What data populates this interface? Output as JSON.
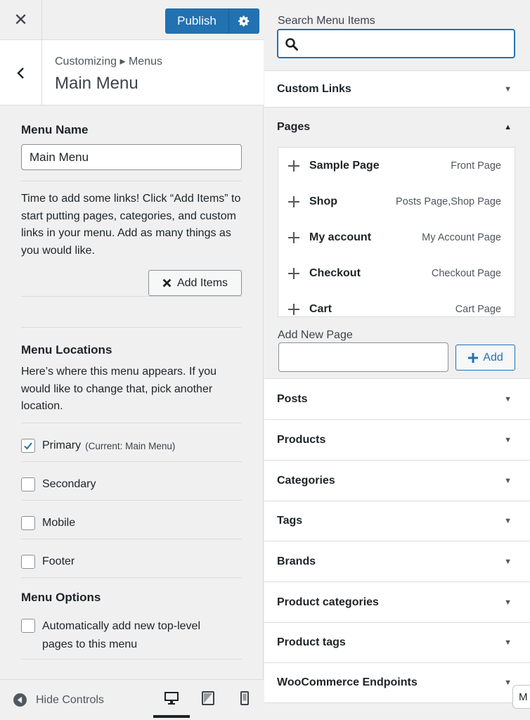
{
  "header": {
    "close_glyph": "✕",
    "publish_label": "Publish"
  },
  "section": {
    "breadcrumb": "Customizing ▸ Menus",
    "title": "Main Menu"
  },
  "menu_name": {
    "label": "Menu Name",
    "value": "Main Menu"
  },
  "intro_text": "Time to add some links! Click “Add Items” to start putting pages, categories, and custom links in your menu. Add as many things as you would like.",
  "add_items_label": "Add Items",
  "locations": {
    "heading": "Menu Locations",
    "description": "Here’s where this menu appears. If you would like to change that, pick another location.",
    "items": [
      {
        "label": "Primary",
        "note": "(Current: Main Menu)",
        "checked": true
      },
      {
        "label": "Secondary",
        "note": "",
        "checked": false
      },
      {
        "label": "Mobile",
        "note": "",
        "checked": false
      },
      {
        "label": "Footer",
        "note": "",
        "checked": false
      }
    ]
  },
  "options": {
    "heading": "Menu Options",
    "auto_add_label": "Automatically add new top-level pages to this menu",
    "auto_add_checked": false
  },
  "footer": {
    "hide_controls_label": "Hide Controls",
    "active_device": "desktop"
  },
  "search": {
    "label": "Search Menu Items",
    "value": "",
    "icon": "search-icon"
  },
  "accordions_top": [
    {
      "title": "Custom Links"
    }
  ],
  "pages": {
    "title": "Pages",
    "items": [
      {
        "name": "Sample Page",
        "type": "Front Page"
      },
      {
        "name": "Shop",
        "type": "Posts Page,Shop Page"
      },
      {
        "name": "My account",
        "type": "My Account Page"
      },
      {
        "name": "Checkout",
        "type": "Checkout Page"
      },
      {
        "name": "Cart",
        "type": "Cart Page"
      }
    ],
    "add_new_label": "Add New Page",
    "add_new_value": "",
    "add_button_label": "Add"
  },
  "accordions_bottom": [
    {
      "title": "Posts"
    },
    {
      "title": "Products"
    },
    {
      "title": "Categories"
    },
    {
      "title": "Tags"
    },
    {
      "title": "Brands"
    },
    {
      "title": "Product categories"
    },
    {
      "title": "Product tags"
    },
    {
      "title": "WooCommerce Endpoints"
    }
  ],
  "edge_tab_text": "M",
  "colors": {
    "accent": "#2271b1",
    "text": "#1d2327",
    "panel_bg": "#f0f0f1"
  }
}
